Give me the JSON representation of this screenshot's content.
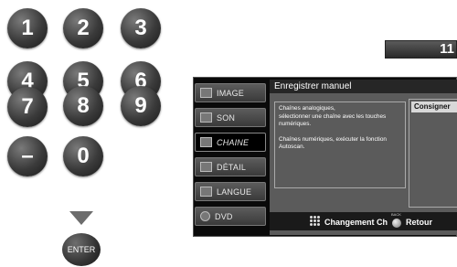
{
  "keypad": {
    "keys": [
      "1",
      "2",
      "3",
      "4",
      "5",
      "6",
      "7",
      "8",
      "9",
      "–",
      "0"
    ],
    "enter": "ENTER"
  },
  "channel_display": "11",
  "menu": {
    "title": "Enregistrer manuel",
    "items": [
      {
        "label": "IMAGE",
        "icon": "image-icon"
      },
      {
        "label": "SON",
        "icon": "music-note-icon"
      },
      {
        "label": "CHAINE",
        "icon": "channel-icon",
        "active": true
      },
      {
        "label": "DÉTAIL",
        "icon": "detail-icon"
      },
      {
        "label": "LANGUE",
        "icon": "language-icon"
      },
      {
        "label": "DVD",
        "icon": "disc-icon"
      }
    ],
    "info": {
      "para1": "Chaînes analogiques,\nsélectionner une chaîne avec les touches numériques.",
      "para2": "Chaînes numériques, exécuter la fonction Autoscan."
    },
    "consigner": "Consigner",
    "bottom": {
      "change": "Changement Ch",
      "back_small": "BACK",
      "retour": "Retour"
    }
  }
}
